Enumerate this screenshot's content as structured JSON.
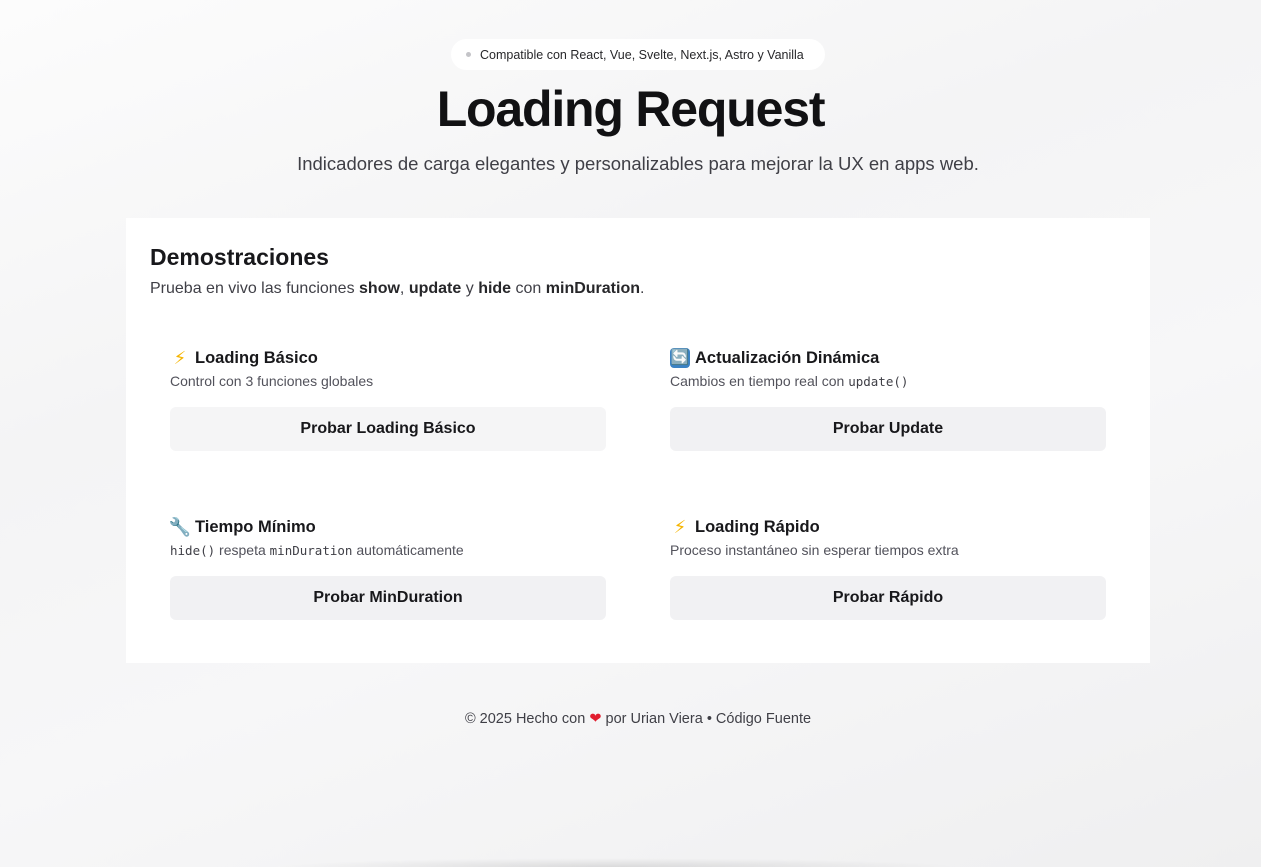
{
  "badge": {
    "text": "Compatible con React, Vue, Svelte, Next.js, Astro y Vanilla"
  },
  "hero": {
    "title": "Loading Request",
    "subtitle": "Indicadores de carga elegantes y personalizables para mejorar la UX en apps web."
  },
  "demos": {
    "title": "Demostraciones",
    "desc_prefix": "Prueba en vivo las funciones",
    "fn_show": "show",
    "sep_comma": ",",
    "fn_update": "update",
    "word_y": "y",
    "fn_hide": "hide",
    "word_con": "con",
    "fn_minduration": "minDuration",
    "desc_end": ".",
    "cards": [
      {
        "icon": "high-voltage-icon",
        "icon_glyph": "⚡",
        "title": "Loading Básico",
        "subtitle": "Control con 3 funciones globales",
        "button": "Probar Loading Básico"
      },
      {
        "icon": "refresh-arrows-icon",
        "icon_glyph": "🔄",
        "title": "Actualización Dinámica",
        "subtitle_text": "Cambios en tiempo real con",
        "subtitle_code": "update()",
        "button": "Probar Update"
      },
      {
        "icon": "wrench-icon",
        "icon_glyph": "🔧",
        "title": "Tiempo Mínimo",
        "subtitle_code1": "hide()",
        "subtitle_mid": "respeta",
        "subtitle_code2": "minDuration",
        "subtitle_end": "automáticamente",
        "button": "Probar MinDuration"
      },
      {
        "icon": "high-voltage-icon",
        "icon_glyph": "⚡",
        "title": "Loading Rápido",
        "subtitle": "Proceso instantáneo sin esperar tiempos extra",
        "button": "Probar Rápido"
      }
    ]
  },
  "footer": {
    "copyright": "© 2025 Hecho con",
    "heart_glyph": "❤",
    "by": "por",
    "author": "Urian Viera",
    "separator": "•",
    "source_link": "Código Fuente"
  },
  "colors": {
    "accent_heart": "#e11d2e",
    "button_bg": "#f1f1f3",
    "bolt": "#f5b400",
    "refresh_icon_bg": "#3b82c4"
  }
}
